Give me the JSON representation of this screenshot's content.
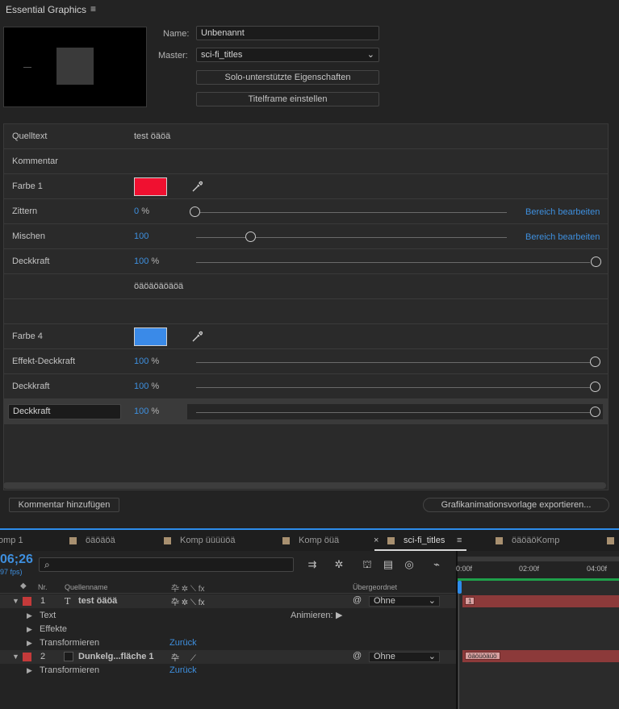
{
  "panel": {
    "title": "Essential Graphics",
    "name_label": "Name:",
    "name_value": "Unbenannt",
    "master_label": "Master:",
    "master_value": "sci-fi_titles",
    "solo_button": "Solo-unterstützte Eigenschaften",
    "titleframe_button": "Titelframe einstellen",
    "add_comment_button": "Kommentar hinzufügen",
    "export_button": "Grafikanimationsvorlage exportieren..."
  },
  "properties": {
    "quelltext_label": "Quelltext",
    "quelltext_value": "test öäöä",
    "kommentar_label": "Kommentar",
    "farbe1_label": "Farbe 1",
    "farbe1_color": "#f01030",
    "zittern_label": "Zittern",
    "zittern_value": "0",
    "zittern_unit": "%",
    "zittern_level": 0,
    "mischen_label": "Mischen",
    "mischen_value": "100",
    "mischen_level": 0.18,
    "deckkraft_label": "Deckkraft",
    "deckkraft_value": "100",
    "deckkraft_unit": "%",
    "deckkraft_level": 1,
    "edit_range": "Bereich bearbeiten",
    "comment_text": "öäöäöäöäöä",
    "farbe4_label": "Farbe 4",
    "farbe4_color": "#3a8ae8",
    "effekt_label": "Effekt-Deckkraft",
    "effekt_value": "100",
    "effekt_unit": "%",
    "deckkraft2_label": "Deckkraft",
    "deckkraft2_value": "100",
    "deckkraft2_unit": "%",
    "deckkraft3_label": "Deckkraft",
    "deckkraft3_value": "100",
    "deckkraft3_unit": "%"
  },
  "timeline": {
    "tabs": [
      "omp 1",
      "öäöäöä",
      "Komp üüüüöä",
      "Komp öüä",
      "sci-fi_titles",
      "öäöäöKomp"
    ],
    "close_glyph": "×",
    "menu_glyph": "≡",
    "timecode": "06;26",
    "fps": "97 fps)",
    "search_icon": "⌕",
    "ruler_labels": [
      "0:00f",
      "02:00f",
      "04:00f"
    ],
    "col_nr": "Nr.",
    "col_source": "Quellenname",
    "col_parent": "Übergeordnet",
    "layer1_nr": "1",
    "layer1_type": "T",
    "layer1_name": "test öäöä",
    "layer1_parent": "Ohne",
    "layer1_text": "Text",
    "layer1_animate": "Animieren:",
    "layer1_effects": "Effekte",
    "layer1_transform": "Transformieren",
    "layer1_reset": "Zurück",
    "layer1_bar_tag": "1",
    "layer2_nr": "2",
    "layer2_name": "Dunkelg...fläche 1",
    "layer2_parent": "Ohne",
    "layer2_transform": "Transformieren",
    "layer2_reset": "Zurück",
    "layer2_bar_tag": "öäöüöäüö",
    "switch_glyphs": "卆 ✲ ⟍ fx"
  },
  "colors": {
    "accent": "#3e8fde",
    "layer_label": "#c43a3a",
    "bar": "#8c3a3a"
  }
}
